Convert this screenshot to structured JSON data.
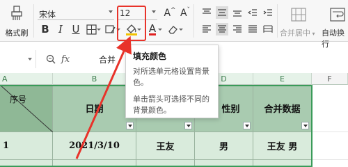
{
  "ribbon": {
    "format_painter_label": "格式刷",
    "font_name": "宋体",
    "font_size": "12",
    "bold": "B",
    "italic": "I",
    "underline": "U",
    "font_color_glyph": "A",
    "increase_font": "A",
    "decrease_font": "A",
    "merge_center_label": "合并居中",
    "wrap_text_label": "自动换行"
  },
  "formula_bar": {
    "fx_label": "fx",
    "content": "合并"
  },
  "columns": [
    "A",
    "B",
    "C",
    "D",
    "E",
    "F"
  ],
  "header_row": {
    "diag_label": "序号",
    "date": "日期",
    "gender": "性别",
    "merged": "合并数据"
  },
  "data_row": {
    "seq": "1",
    "date": "2021/3/10",
    "name": "王友",
    "gender": "男",
    "merged": "王友 男"
  },
  "tooltip": {
    "title": "填充颜色",
    "line1": "对所选单元格设置背景色。",
    "line2": "单击箭头可选择不同的背景颜色。"
  },
  "colors": {
    "highlight": "#e8332a",
    "header_fill": "#a9cbb0",
    "data_fill": "#d9ebdc",
    "selection": "#3a9b59"
  }
}
